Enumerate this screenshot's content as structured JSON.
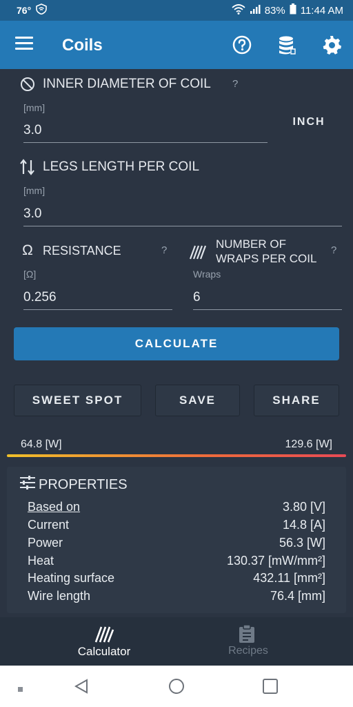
{
  "status": {
    "temp": "76°",
    "battery": "83%",
    "time": "11:44 AM"
  },
  "app_bar": {
    "title": "Coils"
  },
  "inner_diameter": {
    "label": "INNER DIAMETER OF COIL",
    "help": "?",
    "unit": "[mm]",
    "value": "3.0",
    "inch_button": "INCH"
  },
  "legs_length": {
    "label": "LEGS LENGTH PER COIL",
    "unit": "[mm]",
    "value": "3.0"
  },
  "resistance": {
    "label": "RESISTANCE",
    "help": "?",
    "unit": "[Ω]",
    "value": "0.256",
    "symbol": "Ω"
  },
  "wraps": {
    "label_line1": "NUMBER OF",
    "label_line2": "WRAPS PER COIL",
    "help": "?",
    "unit": "Wraps",
    "value": "6"
  },
  "buttons": {
    "calculate": "CALCULATE",
    "sweet_spot": "SWEET SPOT",
    "save": "SAVE",
    "share": "SHARE"
  },
  "range": {
    "low": "64.8 [W]",
    "high": "129.6 [W]"
  },
  "properties": {
    "title": "PROPERTIES",
    "rows": [
      {
        "key": "Based on",
        "value": "3.80 [V]"
      },
      {
        "key": "Current",
        "value": "14.8 [A]"
      },
      {
        "key": "Power",
        "value": "56.3 [W]"
      },
      {
        "key": "Heat",
        "value": "130.37 [mW/mm²]"
      },
      {
        "key": "Heating surface",
        "value": "432.11 [mm²]"
      },
      {
        "key": "Wire length",
        "value": "76.4 [mm]"
      }
    ]
  },
  "bottom_nav": {
    "calculator": "Calculator",
    "recipes": "Recipes"
  },
  "colors": {
    "app_bar": "#2479b6",
    "status_bar": "#1f5f8e",
    "background": "#2b3442",
    "range_start": "#f0c02a",
    "range_end": "#e84a55"
  }
}
